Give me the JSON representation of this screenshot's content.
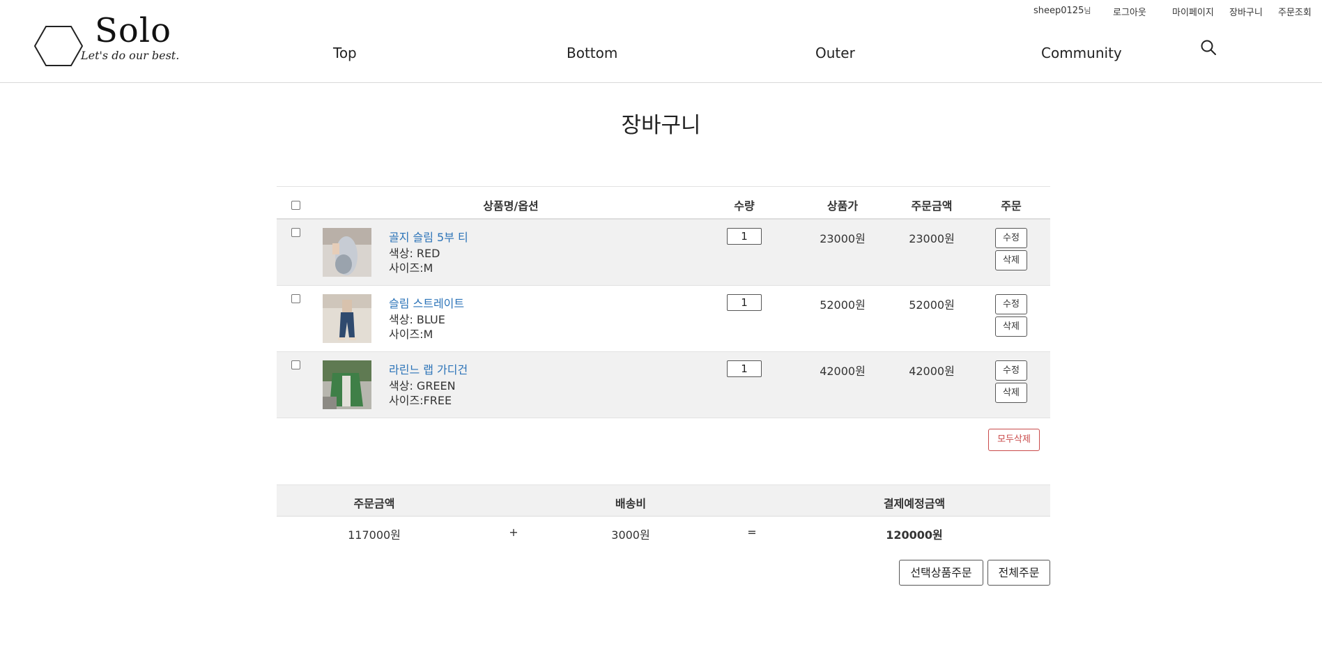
{
  "header": {
    "username": "sheep0125",
    "username_suffix": "님",
    "logout": "로그아웃",
    "mypage": "마이페이지",
    "cart": "장바구니",
    "order_lookup": "주문조회",
    "logo_title": "Solo",
    "logo_sub": "Let's do our best.",
    "nav": [
      "Top",
      "Bottom",
      "Outer",
      "Community"
    ]
  },
  "page_title": "장바구니",
  "table": {
    "columns": {
      "product": "상품명/옵션",
      "qty": "수량",
      "price": "상품가",
      "amount": "주문금액",
      "order": "주문"
    },
    "items": [
      {
        "name": "골지 슬림 5부 티",
        "color": "색상: RED",
        "size": "사이즈:M",
        "qty": "1",
        "price": "23000원",
        "amount": "23000원",
        "edit": "수정",
        "delete": "삭제"
      },
      {
        "name": "슬림 스트레이트",
        "color": "색상: BLUE",
        "size": "사이즈:M",
        "qty": "1",
        "price": "52000원",
        "amount": "52000원",
        "edit": "수정",
        "delete": "삭제"
      },
      {
        "name": "라린느 랩 가디건",
        "color": "색상: GREEN",
        "size": "사이즈:FREE",
        "qty": "1",
        "price": "42000원",
        "amount": "42000원",
        "edit": "수정",
        "delete": "삭제"
      }
    ],
    "delete_all": "모두삭제"
  },
  "summary": {
    "order_amount_label": "주문금액",
    "shipping_label": "배송비",
    "total_label": "결제예정금액",
    "order_amount": "117000원",
    "plus": "+",
    "shipping": "3000원",
    "equals": "=",
    "total": "120000원"
  },
  "actions": {
    "order_selected": "선택상품주문",
    "order_all": "전체주문"
  }
}
